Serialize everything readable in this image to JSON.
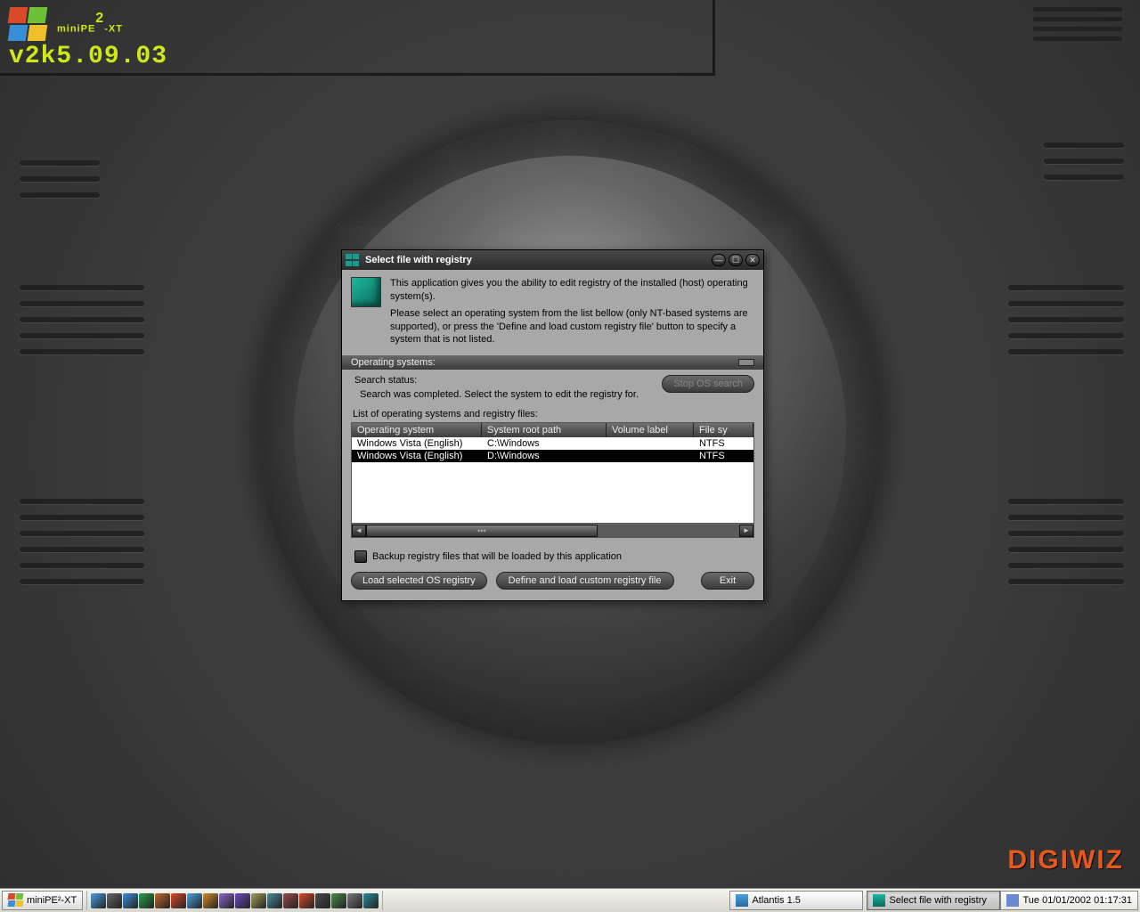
{
  "brand": {
    "name": "miniPE",
    "sup": "2",
    "suffix": "-XT",
    "version": "v2k5.09.03",
    "maker": "DIGIWIZ"
  },
  "dialog": {
    "title": "Select file with registry",
    "intro1": "This application gives you the ability to edit registry of the installed (host) operating system(s).",
    "intro2": "Please select an operating system from the list bellow (only NT-based systems are supported), or press the 'Define and load custom registry file' button to specify a system that is not listed.",
    "group": "Operating systems:",
    "searchLabel": "Search status:",
    "searchText": "Search was completed. Select the system to edit the registry for.",
    "stopBtn": "Stop OS search",
    "listLabel": "List of operating systems and registry files:",
    "cols": {
      "os": "Operating system",
      "path": "System root path",
      "vol": "Volume label",
      "fs": "File sy"
    },
    "rows": [
      {
        "os": "Windows Vista (English)",
        "path": "C:\\Windows",
        "vol": "",
        "fs": "NTFS"
      },
      {
        "os": "Windows Vista (English)",
        "path": "D:\\Windows",
        "vol": "",
        "fs": "NTFS"
      }
    ],
    "backup": "Backup registry files that will be loaded by this application",
    "btnLoad": "Load selected OS registry",
    "btnCustom": "Define and load custom registry file",
    "btnExit": "Exit"
  },
  "taskbar": {
    "start": "miniPE²-XT",
    "task1": "Atlantis 1.5",
    "task2": "Select file with registry",
    "clock": "Tue 01/01/2002 01:17:31"
  },
  "ql_colors": [
    "#4aa0e0",
    "#666",
    "#3a8ed8",
    "#2aa04a",
    "#c06a2a",
    "#d84a2a",
    "#4aa0e0",
    "#d08a2a",
    "#8a6ad0",
    "#6a4ac0",
    "#a0a05a",
    "#4a8a9a",
    "#9a4a4a",
    "#d84a2a",
    "#4a4a4a",
    "#4a8a4a",
    "#7a7a7a",
    "#2a8a9a"
  ]
}
